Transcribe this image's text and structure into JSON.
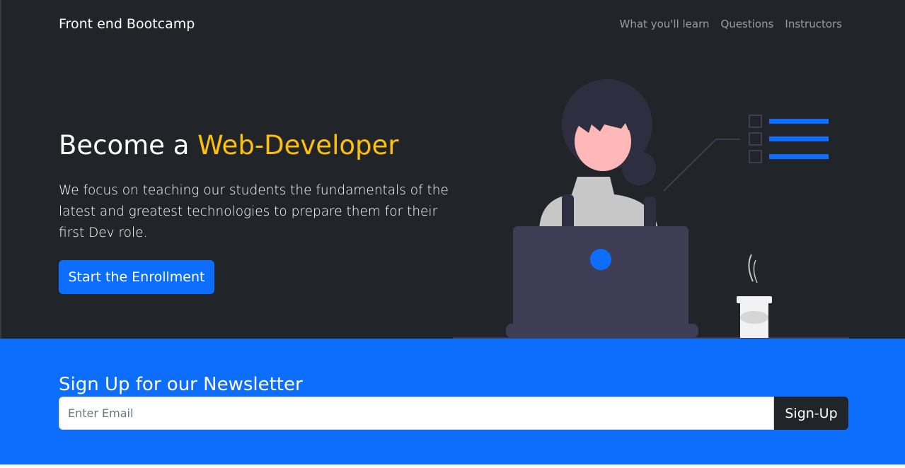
{
  "navbar": {
    "brand": "Front end Bootcamp",
    "links": [
      {
        "label": "What you'll learn"
      },
      {
        "label": "Questions"
      },
      {
        "label": "Instructors"
      }
    ]
  },
  "hero": {
    "title_prefix": "Become a ",
    "title_accent": "Web-Developer",
    "description": "We focus on teaching our students the fundamentals of the latest and greatest technologies to prepare them for their first Dev role.",
    "cta_label": "Start the Enrollment"
  },
  "newsletter": {
    "title": "Sign Up for our Newsletter",
    "email_placeholder": "Enter Email",
    "email_value": "",
    "button_label": "Sign-Up"
  },
  "colors": {
    "dark_background": "#212529",
    "primary_blue": "#0d6efd",
    "accent_yellow": "#ffc107",
    "nav_link": "#9a9da0"
  },
  "illustration": {
    "subject": "woman-at-laptop",
    "items": [
      "checklist-icon",
      "coffee-cup-icon",
      "laptop-icon"
    ]
  }
}
